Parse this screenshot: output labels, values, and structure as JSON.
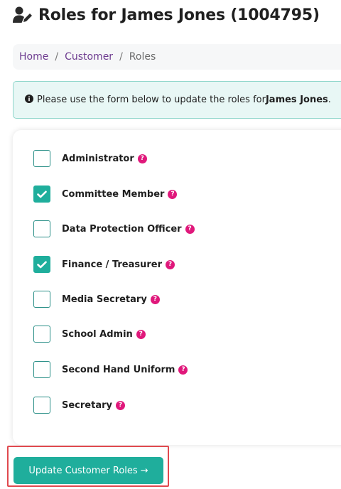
{
  "header": {
    "title": "Roles for James Jones (1004795)",
    "icon": "user-edit-icon"
  },
  "breadcrumb": {
    "items": [
      "Home",
      "Customer",
      "Roles"
    ],
    "separator": "/"
  },
  "alert": {
    "icon": "info-circle-icon",
    "text_before": "Please use the form below to update the roles for ",
    "name": "James Jones",
    "text_after": "."
  },
  "roles": [
    {
      "label": "Administrator",
      "checked": false
    },
    {
      "label": "Committee Member",
      "checked": true
    },
    {
      "label": "Data Protection Officer",
      "checked": false
    },
    {
      "label": "Finance / Treasurer",
      "checked": true
    },
    {
      "label": "Media Secretary",
      "checked": false
    },
    {
      "label": "School Admin",
      "checked": false
    },
    {
      "label": "Second Hand Uniform",
      "checked": false
    },
    {
      "label": "Secretary",
      "checked": false
    }
  ],
  "help_icon": "?",
  "submit": {
    "label": "Update Customer Roles",
    "arrow": "→"
  },
  "colors": {
    "accent": "#1fae9c",
    "help": "#e0187b",
    "link": "#6d3b8f",
    "highlight": "#e0494f"
  }
}
